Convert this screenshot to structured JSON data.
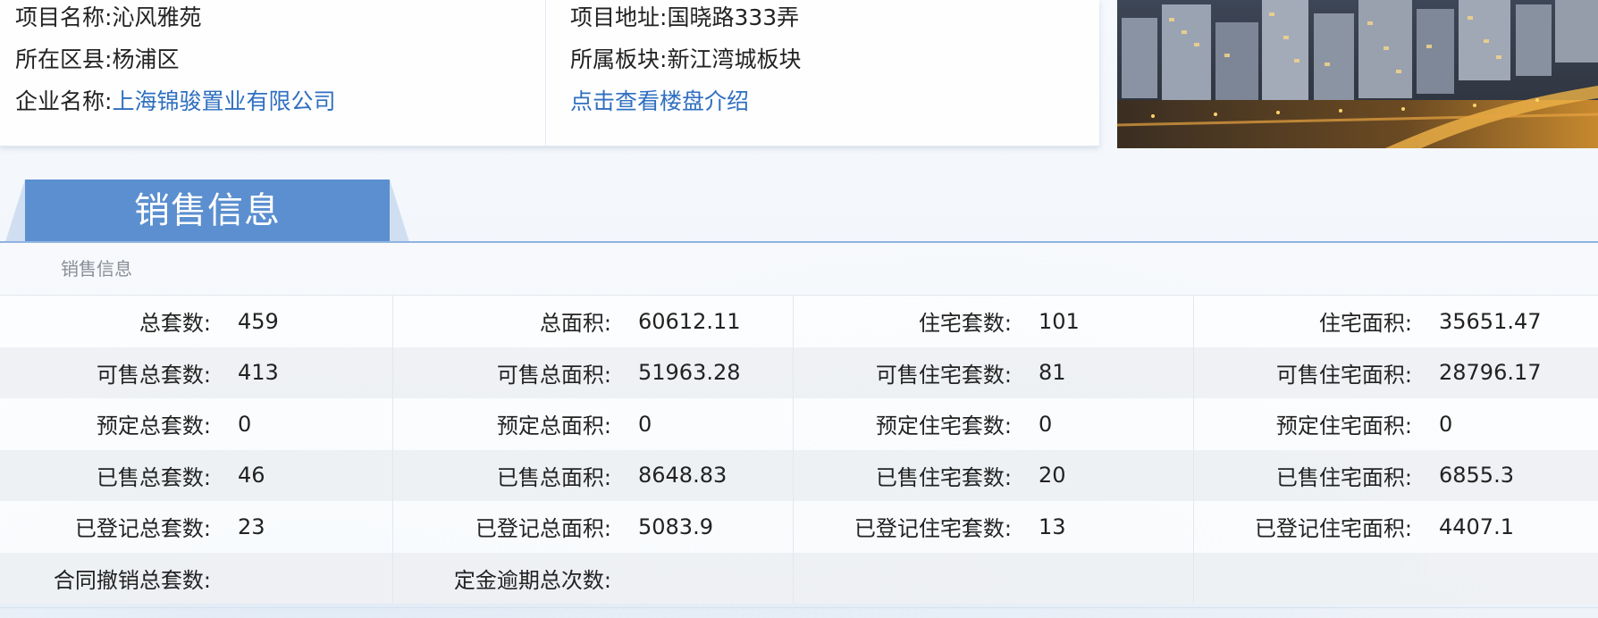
{
  "project": {
    "name_label": "项目名称:",
    "name_value": "沁风雅苑",
    "district_label": "所在区县:",
    "district_value": "杨浦区",
    "company_label": "企业名称:",
    "company_value": "上海锦骏置业有限公司",
    "address_label": "项目地址:",
    "address_value": "国晓路333弄",
    "sector_label": "所属板块:",
    "sector_value": "新江湾城板块",
    "intro_link": "点击查看楼盘介绍"
  },
  "section": {
    "tab_title": "销售信息",
    "caption": "销售信息"
  },
  "sales": {
    "rows": [
      [
        {
          "label": "总套数:",
          "value": "459"
        },
        {
          "label": "总面积:",
          "value": "60612.11"
        },
        {
          "label": "住宅套数:",
          "value": "101"
        },
        {
          "label": "住宅面积:",
          "value": "35651.47"
        }
      ],
      [
        {
          "label": "可售总套数:",
          "value": "413"
        },
        {
          "label": "可售总面积:",
          "value": "51963.28"
        },
        {
          "label": "可售住宅套数:",
          "value": "81"
        },
        {
          "label": "可售住宅面积:",
          "value": "28796.17"
        }
      ],
      [
        {
          "label": "预定总套数:",
          "value": "0"
        },
        {
          "label": "预定总面积:",
          "value": "0"
        },
        {
          "label": "预定住宅套数:",
          "value": "0"
        },
        {
          "label": "预定住宅面积:",
          "value": "0"
        }
      ],
      [
        {
          "label": "已售总套数:",
          "value": "46"
        },
        {
          "label": "已售总面积:",
          "value": "8648.83"
        },
        {
          "label": "已售住宅套数:",
          "value": "20"
        },
        {
          "label": "已售住宅面积:",
          "value": "6855.3"
        }
      ],
      [
        {
          "label": "已登记总套数:",
          "value": "23"
        },
        {
          "label": "已登记总面积:",
          "value": "5083.9"
        },
        {
          "label": "已登记住宅套数:",
          "value": "13"
        },
        {
          "label": "已登记住宅面积:",
          "value": "4407.1"
        }
      ],
      [
        {
          "label": "合同撤销总套数:",
          "value": ""
        },
        {
          "label": "定金逾期总次数:",
          "value": ""
        },
        {
          "label": "",
          "value": ""
        },
        {
          "label": "",
          "value": ""
        }
      ]
    ]
  },
  "colors": {
    "tab_blue": "#5b8fd0",
    "link_blue": "#2f6fc0",
    "row_alt": "#eef0f3"
  }
}
